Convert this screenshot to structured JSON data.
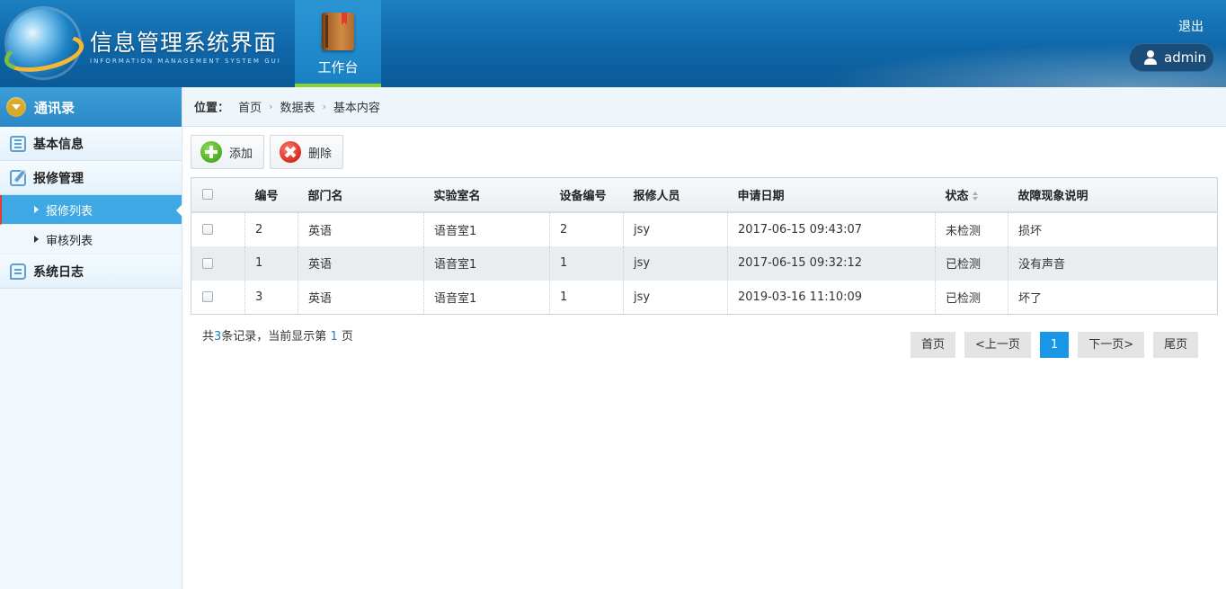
{
  "header": {
    "title": "信息管理系统界面",
    "subtitle": "INFORMATION MANAGEMENT SYSTEM GUI",
    "nav_item": "工作台",
    "logout": "退出",
    "user": "admin"
  },
  "sidebar": {
    "head": "通讯录",
    "items": [
      {
        "label": "基本信息",
        "type": "group",
        "icon": "list-icon"
      },
      {
        "label": "报修管理",
        "type": "group",
        "icon": "edit-icon"
      },
      {
        "label": "报修列表",
        "type": "sub",
        "active": true
      },
      {
        "label": "审核列表",
        "type": "sub",
        "active": false
      },
      {
        "label": "系统日志",
        "type": "group",
        "icon": "chat-icon"
      }
    ]
  },
  "breadcrumb": {
    "prefix": "位置：",
    "items": [
      "首页",
      "数据表",
      "基本内容"
    ]
  },
  "toolbar": {
    "add": "添加",
    "delete": "删除"
  },
  "table": {
    "columns": [
      "编号",
      "部门名",
      "实验室名",
      "设备编号",
      "报修人员",
      "申请日期",
      "状态",
      "故障现象说明"
    ],
    "rows": [
      [
        "2",
        "英语",
        "语音室1",
        "2",
        "jsy",
        "2017-06-15 09:43:07",
        "未检测",
        "损坏"
      ],
      [
        "1",
        "英语",
        "语音室1",
        "1",
        "jsy",
        "2017-06-15 09:32:12",
        "已检测",
        "没有声音"
      ],
      [
        "3",
        "英语",
        "语音室1",
        "1",
        "jsy",
        "2019-03-16 11:10:09",
        "已检测",
        "坏了"
      ]
    ]
  },
  "summary": {
    "text1": "共",
    "count": "3",
    "text2": "条记录，当前显示第 ",
    "page": "1",
    "text3": " 页"
  },
  "pager": {
    "first": "首页",
    "prev": "<上一页",
    "current": "1",
    "next": "下一页>",
    "last": "尾页"
  },
  "colors": {
    "accent": "#1a96e6",
    "header_bg": "#0f67a8",
    "active_item": "#3fa9e5"
  }
}
